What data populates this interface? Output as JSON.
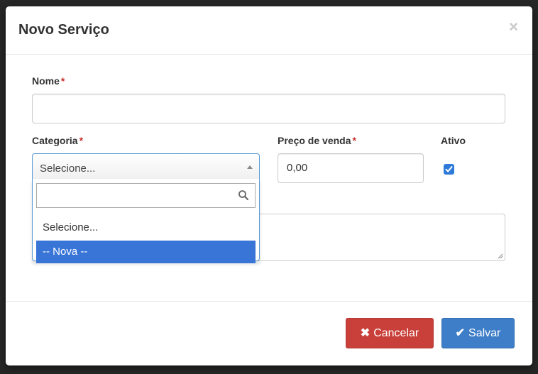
{
  "modal": {
    "title": "Novo Serviço",
    "close_symbol": "×"
  },
  "form": {
    "nome": {
      "label": "Nome",
      "required_mark": "*",
      "value": ""
    },
    "categoria": {
      "label": "Categoria",
      "required_mark": "*",
      "selected": "Selecione...",
      "search_value": "",
      "options": [
        "Selecione...",
        "-- Nova --"
      ],
      "highlighted_option": "-- Nova --"
    },
    "preco_venda": {
      "label": "Preço de venda",
      "required_mark": "*",
      "value": "0,00"
    },
    "ativo": {
      "label": "Ativo",
      "checked": true
    },
    "descricao": {
      "value": ""
    }
  },
  "footer": {
    "cancel_label": "Cancelar",
    "cancel_icon": "times-icon",
    "save_label": "Salvar",
    "save_icon": "check-icon"
  },
  "colors": {
    "danger": "#c9403a",
    "primary": "#3e7ec8",
    "highlight": "#3875d7",
    "required": "#c9302c"
  }
}
